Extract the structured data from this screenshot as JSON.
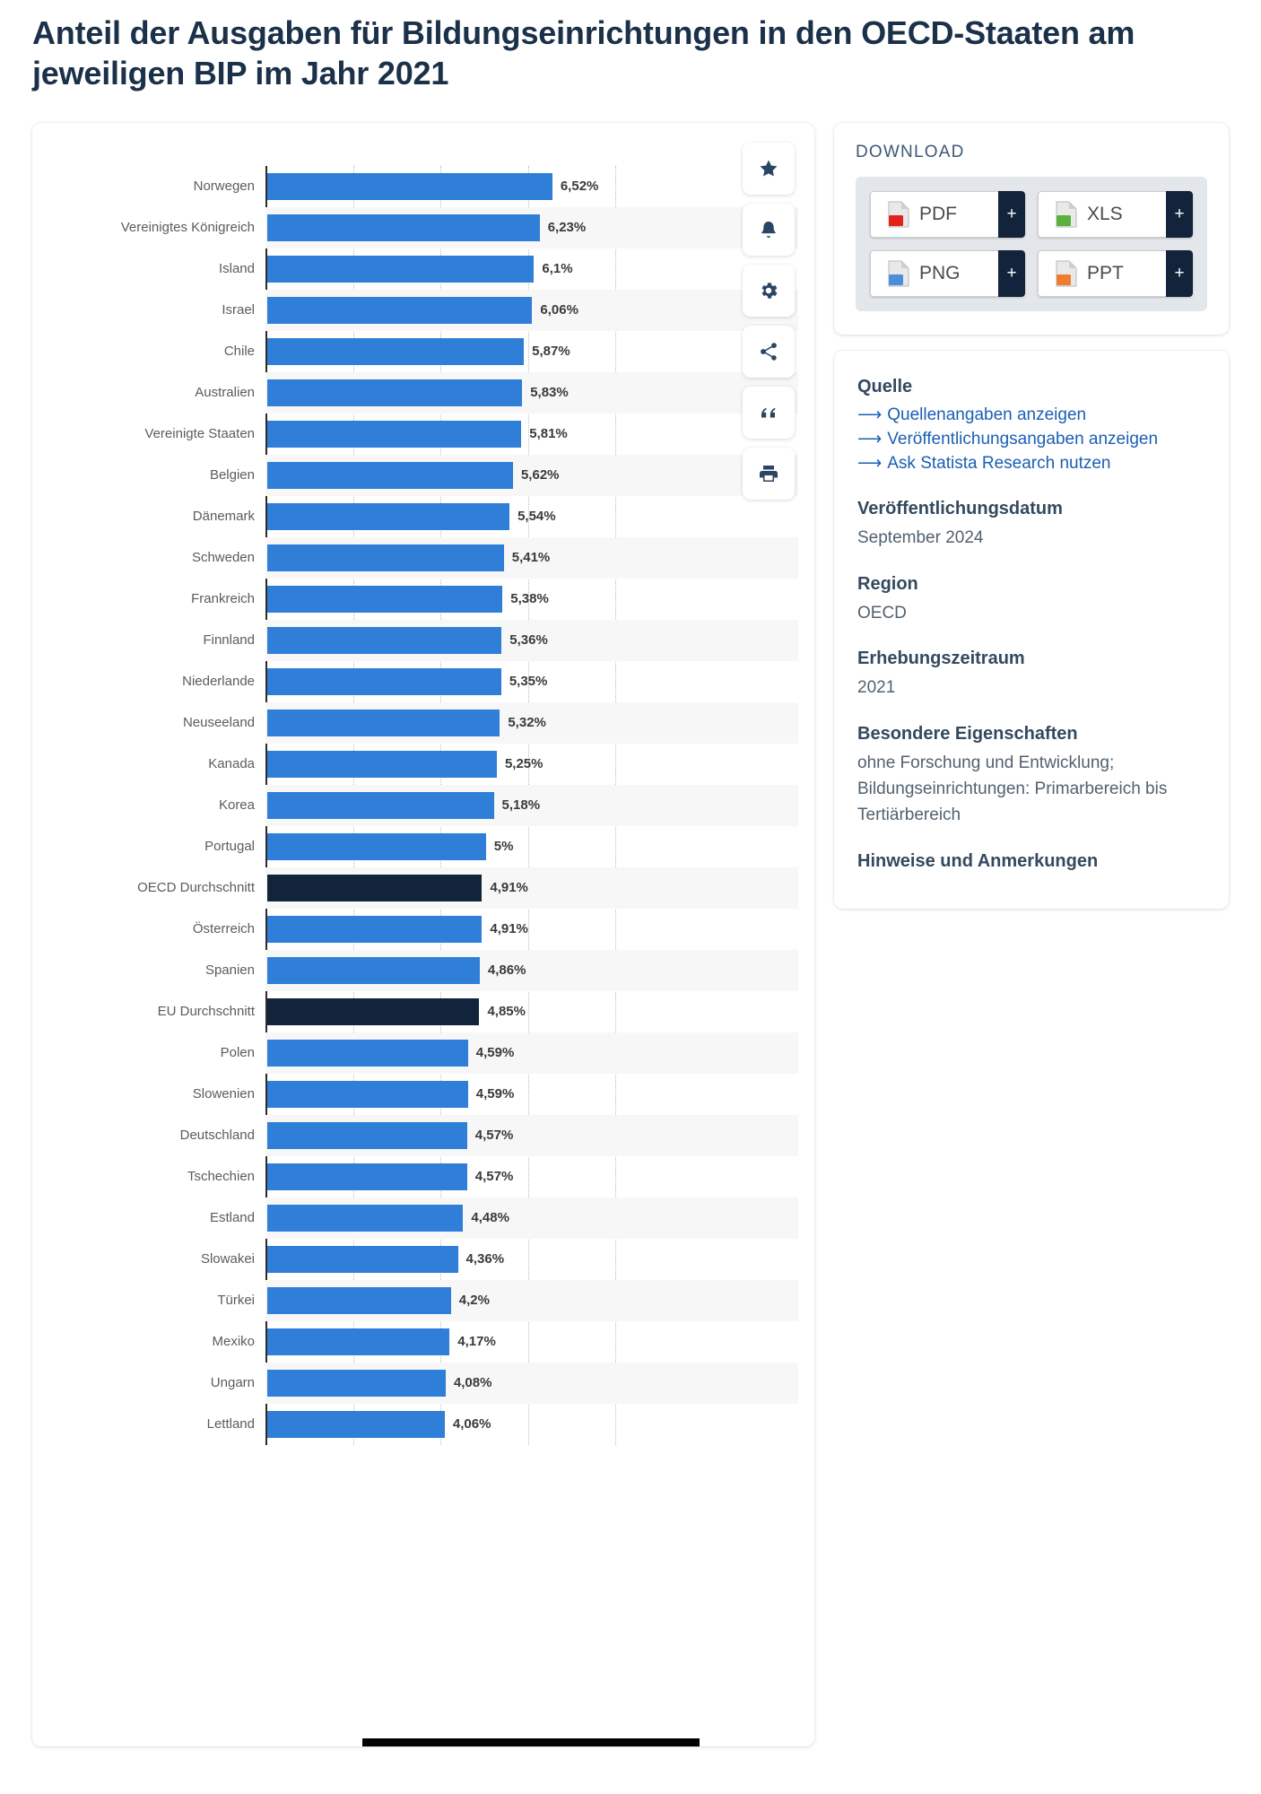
{
  "page_title": "Anteil der Ausgaben für Bildungseinrichtungen in den OECD-Staaten am jeweiligen BIP im Jahr 2021",
  "chart_data": {
    "type": "bar",
    "orientation": "horizontal",
    "title": "Anteil der Ausgaben für Bildungseinrichtungen in den OECD-Staaten am jeweiligen BIP im Jahr 2021",
    "xlabel": "",
    "ylabel": "",
    "unit": "%",
    "xlim": [
      0,
      8
    ],
    "grid": true,
    "gridlines": [
      2,
      4,
      6,
      8
    ],
    "legend": "none",
    "highlight_color": "#12243c",
    "bar_color": "#2f7ed8",
    "categories": [
      "Norwegen",
      "Vereinigtes Königreich",
      "Island",
      "Israel",
      "Chile",
      "Australien",
      "Vereinigte Staaten",
      "Belgien",
      "Dänemark",
      "Schweden",
      "Frankreich",
      "Finnland",
      "Niederlande",
      "Neuseeland",
      "Kanada",
      "Korea",
      "Portugal",
      "OECD Durchschnitt",
      "Österreich",
      "Spanien",
      "EU Durchschnitt",
      "Polen",
      "Slowenien",
      "Deutschland",
      "Tschechien",
      "Estland",
      "Slowakei",
      "Türkei",
      "Mexiko",
      "Ungarn",
      "Lettland"
    ],
    "values": [
      6.52,
      6.23,
      6.1,
      6.06,
      5.87,
      5.83,
      5.81,
      5.62,
      5.54,
      5.41,
      5.38,
      5.36,
      5.35,
      5.32,
      5.25,
      5.18,
      5.0,
      4.91,
      4.91,
      4.86,
      4.85,
      4.59,
      4.59,
      4.57,
      4.57,
      4.48,
      4.36,
      4.2,
      4.17,
      4.08,
      4.06
    ],
    "value_labels": [
      "6,52%",
      "6,23%",
      "6,1%",
      "6,06%",
      "5,87%",
      "5,83%",
      "5,81%",
      "5,62%",
      "5,54%",
      "5,41%",
      "5,38%",
      "5,36%",
      "5,35%",
      "5,32%",
      "5,25%",
      "5,18%",
      "5%",
      "4,91%",
      "4,91%",
      "4,86%",
      "4,85%",
      "4,59%",
      "4,59%",
      "4,57%",
      "4,57%",
      "4,48%",
      "4,36%",
      "4,2%",
      "4,17%",
      "4,08%",
      "4,06%"
    ],
    "highlighted": [
      "OECD Durchschnitt",
      "EU Durchschnitt"
    ]
  },
  "toolbar": {
    "items": [
      {
        "name": "favorite-icon",
        "label": "Favorit"
      },
      {
        "name": "bell-icon",
        "label": "Benachrichtigung"
      },
      {
        "name": "gear-icon",
        "label": "Einstellungen"
      },
      {
        "name": "share-icon",
        "label": "Teilen"
      },
      {
        "name": "quote-icon",
        "label": "Zitieren"
      },
      {
        "name": "print-icon",
        "label": "Drucken"
      }
    ]
  },
  "download": {
    "heading": "DOWNLOAD",
    "buttons": [
      {
        "label": "PDF",
        "plus": "+",
        "icon": "pdf-file-icon",
        "color": "#e2231a"
      },
      {
        "label": "XLS",
        "plus": "+",
        "icon": "xls-file-icon",
        "color": "#59b13e"
      },
      {
        "label": "PNG",
        "plus": "+",
        "icon": "png-file-icon",
        "color": "#4a90d9"
      },
      {
        "label": "PPT",
        "plus": "+",
        "icon": "ppt-file-icon",
        "color": "#ed7d31"
      }
    ]
  },
  "meta": {
    "source_heading": "Quelle",
    "source_links": [
      "Quellenangaben anzeigen",
      "Veröffentlichungsangaben anzeigen",
      "Ask Statista Research nutzen"
    ],
    "publication_heading": "Veröffentlichungsdatum",
    "publication_value": "September 2024",
    "region_heading": "Region",
    "region_value": "OECD",
    "period_heading": "Erhebungszeitraum",
    "period_value": "2021",
    "features_heading": "Besondere Eigenschaften",
    "features_value": "ohne Forschung und Entwicklung; Bildungseinrichtungen: Primarbereich bis Tertiärbereich",
    "notes_heading": "Hinweise und Anmerkungen"
  }
}
